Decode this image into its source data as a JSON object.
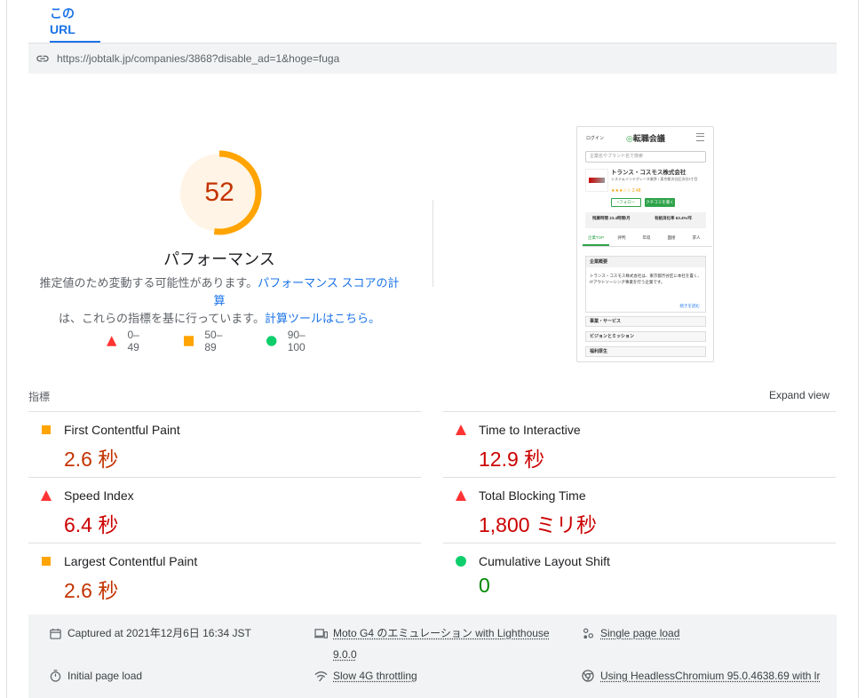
{
  "tab": {
    "label": "この URL"
  },
  "url": {
    "text": "https://jobtalk.jp/companies/3868?disable_ad=1&hoge=fuga"
  },
  "gauge": {
    "score": "52",
    "percent": 52,
    "color": "#ffa400"
  },
  "performance": {
    "title": "パフォーマンス",
    "desc_1": "推定値のため変動する可能性があります。",
    "link_1": "パフォーマンス スコアの計算",
    "desc_2": "は、これらの指標を基に行っています。",
    "link_2": "計算ツールはこちら。"
  },
  "legend": [
    {
      "label": "0–49",
      "icon": "red-triangle-icon"
    },
    {
      "label": "50–89",
      "icon": "orange-square-icon"
    },
    {
      "label": "90–100",
      "icon": "green-circle-icon"
    }
  ],
  "screenshot": {
    "login": "ログイン",
    "logo": "転職会議",
    "search": "企業名やブランド名で検索",
    "company": "トランス・コスモス株式会社",
    "company_sub": "システムインテグレータ業界 / 東京都渋谷区渋谷3丁目",
    "rating": "2.48",
    "follow": "+フォロー",
    "review": "クチコミを書く",
    "stat_1": "残業時間 23.4時間/月",
    "stat_2": "有給消化率 63.4%/年",
    "tabs": [
      "企業TOP",
      "評判",
      "年収",
      "面接",
      "求人"
    ],
    "section_1": "企業概要",
    "body": "トランス・コスモス株式会社は、東京都渋谷区に本社を置く、ITアウトソーシング事業を行う企業です。",
    "more": "続きを読む",
    "section_2": "事業・サービス",
    "section_3": "ビジョンとミッション",
    "section_4": "福利厚生"
  },
  "metrics_header": {
    "label": "指標",
    "expand": "Expand view"
  },
  "metrics": [
    {
      "name": "First Contentful Paint",
      "value": "2.6 秒",
      "status": "average"
    },
    {
      "name": "Time to Interactive",
      "value": "12.9 秒",
      "status": "fail"
    },
    {
      "name": "Speed Index",
      "value": "6.4 秒",
      "status": "fail"
    },
    {
      "name": "Total Blocking Time",
      "value": "1,800 ミリ秒",
      "status": "fail"
    },
    {
      "name": "Largest Contentful Paint",
      "value": "2.6 秒",
      "status": "average"
    },
    {
      "name": "Cumulative Layout Shift",
      "value": "0",
      "status": "pass"
    }
  ],
  "footer": {
    "captured": "Captured at 2021年12月6日 16:34 JST",
    "device": "Moto G4 のエミュレーション with Lighthouse 9.0.0",
    "device_line1": "Moto G4 のエミュレーション with Lighthouse",
    "device_line2": "9.0.0",
    "load": "Single page load",
    "initial": "Initial page load",
    "throttle": "Slow 4G throttling",
    "browser": "Using HeadlessChromium 95.0.4638.69 with lr"
  },
  "colors": {
    "fail": "#cc0000",
    "average": "#c33300",
    "pass": "#008800",
    "accent": "#1a73e8"
  }
}
